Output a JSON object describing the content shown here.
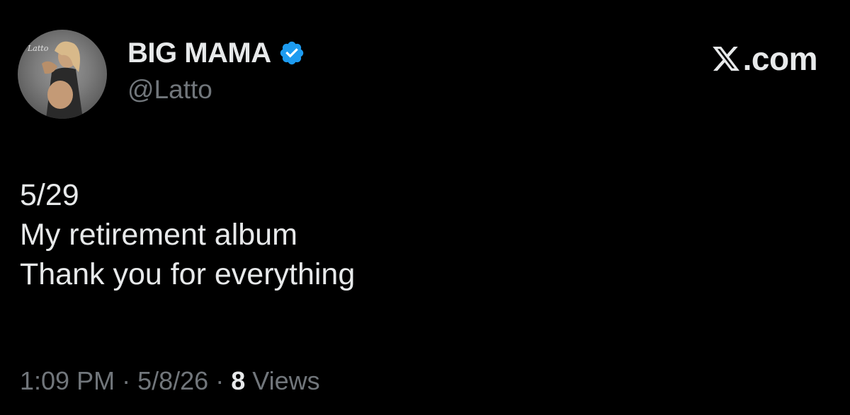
{
  "author": {
    "display_name": "BIG MAMA",
    "handle": "@Latto",
    "verified": true,
    "avatar_icon": "profile-photo",
    "verified_icon": "verified-badge-icon",
    "verified_color": "#1d9bf0"
  },
  "brand": {
    "logo_icon": "x-logo-icon",
    "text": ".com"
  },
  "tweet": {
    "lines": [
      "5/29",
      "My retirement album",
      "Thank you for everything"
    ]
  },
  "meta": {
    "time": "1:09 PM",
    "separator": "·",
    "date": "5/8/26",
    "views_count": "8",
    "views_label": "Views"
  },
  "colors": {
    "background": "#000000",
    "primary_text": "#e7e9ea",
    "secondary_text": "#71767b"
  }
}
